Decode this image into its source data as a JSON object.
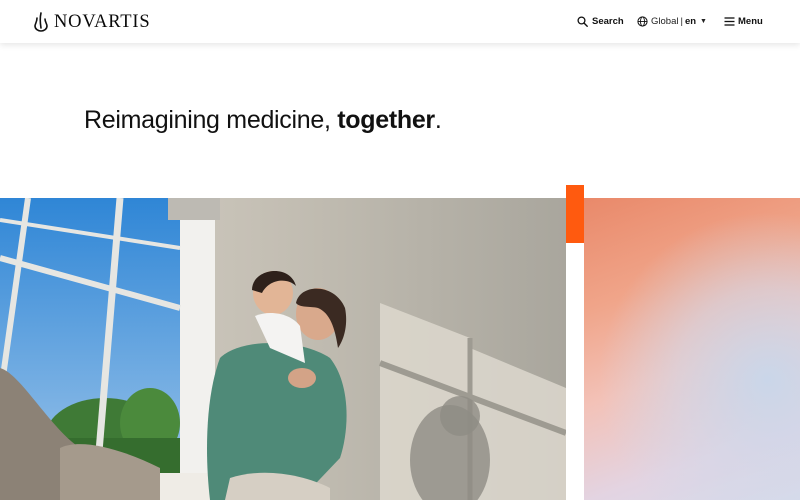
{
  "header": {
    "brand": "NOVARTIS",
    "search_label": "Search",
    "region_label": "Global",
    "separator": "|",
    "language_label": "en",
    "menu_label": "Menu"
  },
  "hero": {
    "headline_regular": "Reimagining medicine,",
    "headline_bold": "together",
    "headline_end": "."
  },
  "colors": {
    "accent": "#ff5a0f",
    "text": "#111111",
    "background": "#ffffff"
  },
  "icons": {
    "search": "search-icon",
    "globe": "globe-icon",
    "caret": "caret-down-icon",
    "menu": "hamburger-icon",
    "logo": "novartis-flame-icon"
  }
}
